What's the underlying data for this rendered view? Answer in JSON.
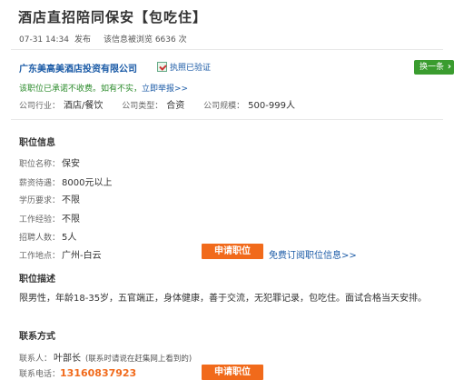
{
  "job": {
    "title": "酒店直招陪同保安【包吃住】",
    "posted_date": "07-31 14:34",
    "posted_label": "发布",
    "views_text": "该信息被浏览 6636 次"
  },
  "company": {
    "name": "广东美高美酒店投资有限公司",
    "license_label": "执照已验证",
    "switch_label": "换一条",
    "promise_text": "该职位已承诺不收费。如有不实，",
    "report_link": "立即举报>>",
    "industry_label": "公司行业：",
    "industry": "酒店/餐饮",
    "type_label": "公司类型：",
    "type": "合资",
    "size_label": "公司规模：",
    "size": "500-999人"
  },
  "position": {
    "section_title": "职位信息",
    "fields": [
      {
        "label": "职位名称：",
        "value": "保安"
      },
      {
        "label": "薪资待遇：",
        "value": "8000元以上"
      },
      {
        "label": "学历要求：",
        "value": "不限"
      },
      {
        "label": "工作经验：",
        "value": "不限"
      },
      {
        "label": "招聘人数：",
        "value": "5人"
      },
      {
        "label": "工作地点：",
        "value": "广州-白云"
      }
    ],
    "apply_label": "申请职位",
    "subscribe_label": "免费订阅职位信息>>"
  },
  "description": {
    "section_title": "职位描述",
    "text": "限男性，年龄18-35岁，五官端正，身体健康，善于交流，无犯罪记录，包吃住。面试合格当天安排。"
  },
  "contact": {
    "section_title": "联系方式",
    "person_label": "联系人：",
    "person": "叶部长",
    "person_note": "(联系时请说在赶集网上看到的)",
    "phone_label": "联系电话：",
    "phone": "13160837923",
    "apply_label": "申请职位"
  },
  "colors": {
    "accent_orange": "#f16a1b",
    "link_blue": "#1a5aa6",
    "switch_green": "#3a9c2f"
  }
}
